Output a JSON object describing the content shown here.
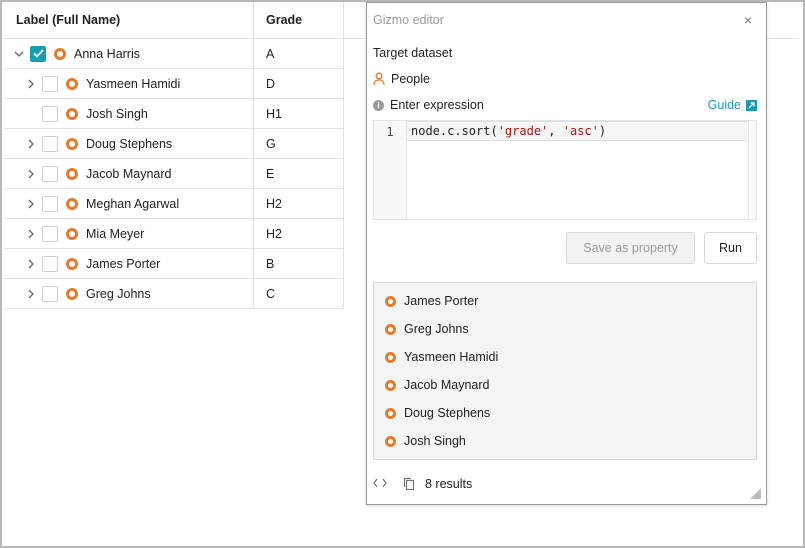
{
  "table": {
    "columns": {
      "label": "Label (Full Name)",
      "grade": "Grade"
    },
    "rows": [
      {
        "name": "Anna Harris",
        "grade": "A",
        "expanded": true,
        "checked": true,
        "chevron": "chevron-down-icon"
      },
      {
        "name": "Yasmeen Hamidi",
        "grade": "D",
        "expanded": false,
        "checked": false,
        "chevron": "chevron-right-icon"
      },
      {
        "name": "Josh Singh",
        "grade": "H1",
        "expanded": false,
        "checked": false,
        "chevron": ""
      },
      {
        "name": "Doug Stephens",
        "grade": "G",
        "expanded": false,
        "checked": false,
        "chevron": "chevron-right-icon"
      },
      {
        "name": "Jacob Maynard",
        "grade": "E",
        "expanded": false,
        "checked": false,
        "chevron": "chevron-right-icon"
      },
      {
        "name": "Meghan Agarwal",
        "grade": "H2",
        "expanded": false,
        "checked": false,
        "chevron": "chevron-right-icon"
      },
      {
        "name": "Mia Meyer",
        "grade": "H2",
        "expanded": false,
        "checked": false,
        "chevron": "chevron-right-icon"
      },
      {
        "name": "James Porter",
        "grade": "B",
        "expanded": false,
        "checked": false,
        "chevron": "chevron-right-icon"
      },
      {
        "name": "Greg Johns",
        "grade": "C",
        "expanded": false,
        "checked": false,
        "chevron": "chevron-right-icon"
      }
    ]
  },
  "gizmo": {
    "title": "Gizmo editor",
    "close": "×",
    "target_label": "Target dataset",
    "dataset": "People",
    "expression_label": "Enter expression",
    "guide_label": "Guide",
    "line_number": "1",
    "code": {
      "prefix": "node.c.sort(",
      "arg1": "'grade'",
      "sep": ", ",
      "arg2": "'asc'",
      "suffix": ")"
    },
    "save_label": "Save as property",
    "run_label": "Run",
    "results": [
      "James Porter",
      "Greg Johns",
      "Yasmeen Hamidi",
      "Jacob Maynard",
      "Doug Stephens",
      "Josh Singh"
    ],
    "results_count": "8 results"
  },
  "colors": {
    "accent": "#1a9bb0",
    "node": "#e57a2a",
    "border": "#e2e2e2"
  }
}
